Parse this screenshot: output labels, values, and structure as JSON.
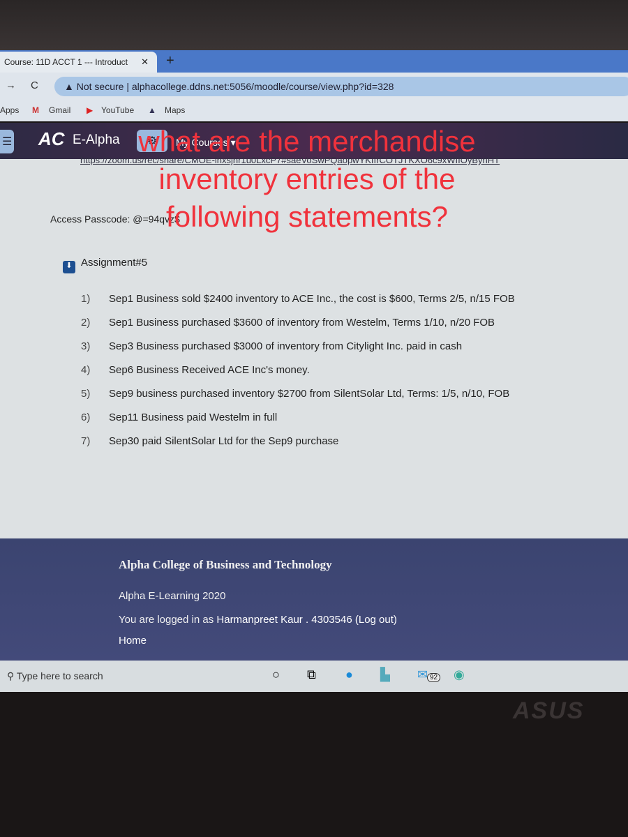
{
  "browser": {
    "tab_title": "Course: 11D ACCT 1 --- Introduct",
    "close": "✕",
    "new_tab": "+",
    "back": "→",
    "reload": "C",
    "security": "▲ Not secure",
    "url": "alphacollege.ddns.net:5056/moodle/course/view.php?id=328",
    "bookmarks": [
      "Apps",
      "Gmail",
      "YouTube",
      "Maps"
    ]
  },
  "navbar": {
    "menu": "☰",
    "logo": "AC",
    "brand": "E-Alpha",
    "gear": "⚙",
    "my_courses": "My Courses ▾"
  },
  "content": {
    "zoom_link": "https://zoom.us/rec/share/CMOE-lnxsjnr1u0LxcP7#saeVoSwPQaopwYKIIrCOTJTKXO6c9xWIIOyBynHT",
    "passcode": "Access Passcode: @=94qvz$",
    "assignment": "Assignment#5",
    "items": [
      {
        "n": "1)",
        "text": "Sep1 Business sold $2400 inventory to ACE Inc., the cost is $600, Terms 2/5, n/15 FOB"
      },
      {
        "n": "2)",
        "text": "Sep1  Business purchased $3600 of inventory from Westelm, Terms 1/10, n/20 FOB"
      },
      {
        "n": "3)",
        "text": "Sep3  Business purchased $3000 of inventory from  Citylight Inc.  paid in cash"
      },
      {
        "n": "4)",
        "text": "Sep6  Business Received  ACE Inc's money."
      },
      {
        "n": "5)",
        "text": "Sep9 business purchased inventory $2700 from SilentSolar Ltd, Terms: 1/5, n/10, FOB"
      },
      {
        "n": "6)",
        "text": "Sep11 Business paid Westelm in full"
      },
      {
        "n": "7)",
        "text": "Sep30 paid SilentSolar Ltd for the Sep9 purchase"
      }
    ]
  },
  "overlay": {
    "question": "what are the merchandise inventory entries of the following statements?"
  },
  "footer": {
    "college": "Alpha College of Business and Technology",
    "elearning": "Alpha E-Learning 2020",
    "logged_prefix": "You are logged in as ",
    "user": "Harmanpreet Kaur . 4303546",
    "logout": "(Log out)",
    "home": "Home"
  },
  "taskbar": {
    "search_placeholder": "Type here to search",
    "mail_badge": "92"
  },
  "laptop": {
    "brand": "ASUS"
  },
  "colors": {
    "overlay_text": "#f0323c",
    "navbar": "#2e2a44",
    "footer": "#3b4470"
  }
}
